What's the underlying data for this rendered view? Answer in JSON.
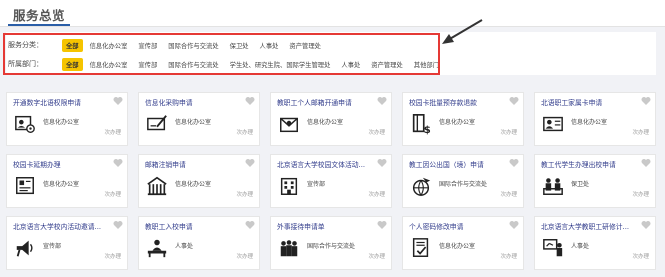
{
  "header": {
    "title": "服务总览"
  },
  "filters": {
    "category_label": "服务分类：",
    "category_options": [
      "全部",
      "信息化办公室",
      "宣传部",
      "国际合作与交流处",
      "保卫处",
      "人事处",
      "资产管理处"
    ],
    "department_label": "所属部门：",
    "department_options": [
      "全部",
      "信息化办公室",
      "宣传部",
      "国际合作与交流处",
      "学生处、研究生院、国际学生管理处",
      "人事处",
      "资产管理处",
      "其他部门"
    ]
  },
  "cards": [
    {
      "title": "开通数字北语权限申请",
      "dept": "信息化办公室",
      "times": "次办理",
      "icon": "id-card-gear-icon"
    },
    {
      "title": "信息化采购申请",
      "dept": "信息化办公室",
      "times": "次办理",
      "icon": "check-pen-icon"
    },
    {
      "title": "教职工个人邮箱开通申请",
      "dept": "信息化办公室",
      "times": "次办理",
      "icon": "envelope-icon"
    },
    {
      "title": "校园卡批量预存款退款",
      "dept": "信息化办公室",
      "times": "次办理",
      "icon": "card-refund-icon"
    },
    {
      "title": "北语职工家属卡申请",
      "dept": "信息化办公室",
      "times": "次办理",
      "icon": "family-card-icon"
    },
    {
      "title": "校园卡延期办理",
      "dept": "信息化办公室",
      "times": "次办理",
      "icon": "certificate-icon"
    },
    {
      "title": "邮箱注销申请",
      "dept": "信息化办公室",
      "times": "次办理",
      "icon": "mailbox-gate-icon"
    },
    {
      "title": "北京语言大学校园文体活动...",
      "dept": "宣传部",
      "times": "次办理",
      "icon": "building-icon"
    },
    {
      "title": "教工因公出国（境）申请",
      "dept": "国际合作与交流处",
      "times": "次办理",
      "icon": "airplane-globe-icon"
    },
    {
      "title": "教工代学生办理出校申请",
      "dept": "保卫处",
      "times": "次办理",
      "icon": "security-desk-icon"
    },
    {
      "title": "北京语言大学校内活动邀请...",
      "dept": "宣传部",
      "times": "次办理",
      "icon": "speaker-icon"
    },
    {
      "title": "教职工入校申请",
      "dept": "人事处",
      "times": "次办理",
      "icon": "reception-icon"
    },
    {
      "title": "外事接待申请单",
      "dept": "国际合作与交流处",
      "times": "次办理",
      "icon": "group-icon"
    },
    {
      "title": "个人密码修改申请",
      "dept": "信息化办公室",
      "times": "次办理",
      "icon": "password-doc-icon"
    },
    {
      "title": "北京语言大学教职工研修计...",
      "dept": "人事处",
      "times": "次办理",
      "icon": "presentation-icon"
    }
  ],
  "colors": {
    "accent": "#f5c400",
    "title_blue": "#2f3a8a",
    "highlight": "#e53935"
  }
}
